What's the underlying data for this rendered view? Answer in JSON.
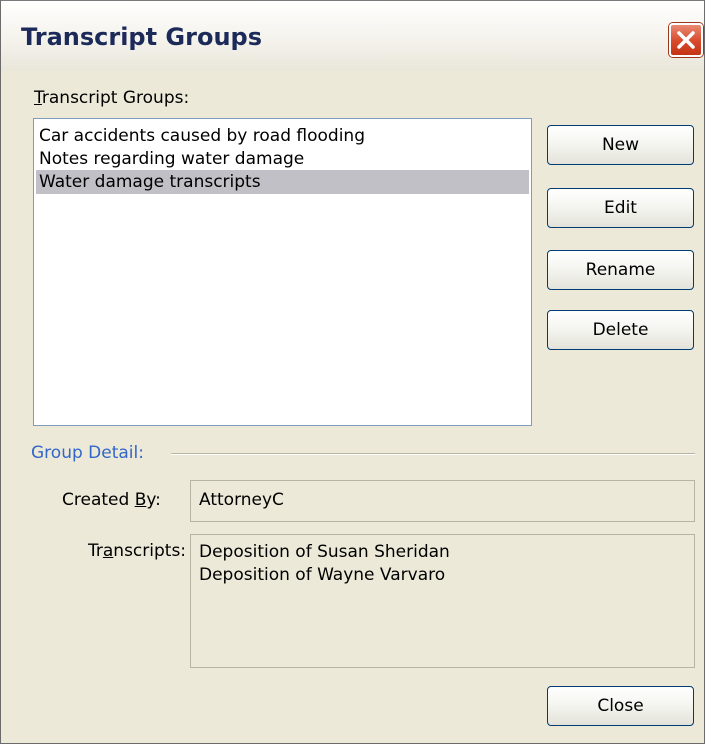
{
  "window": {
    "title": "Transcript Groups",
    "close_icon": "close-x-icon"
  },
  "groups_label": {
    "mnemonic": "T",
    "rest": "ranscript Groups:"
  },
  "groups_list": {
    "items": [
      "Car accidents caused by road flooding",
      "Notes regarding water damage",
      "Water damage transcripts"
    ],
    "selected_index": 2
  },
  "buttons": {
    "new": "New",
    "edit": "Edit",
    "rename": "Rename",
    "delete": "Delete",
    "close": "Close"
  },
  "group_detail": {
    "section_label": "Group Detail:",
    "created_by_label": {
      "before": "Created ",
      "mnemonic": "B",
      "after": "y:"
    },
    "created_by_value": "AttorneyC",
    "transcripts_label": {
      "before": "Tr",
      "mnemonic": "a",
      "after": "nscripts:"
    },
    "transcripts": [
      "Deposition of Susan Sheridan",
      "Deposition of Wayne Varvaro"
    ]
  },
  "colors": {
    "dialog_bg": "#ece9d8",
    "selection_bg": "#c1c0c6",
    "section_label": "#3266c9",
    "close_button": "#d7492b"
  }
}
